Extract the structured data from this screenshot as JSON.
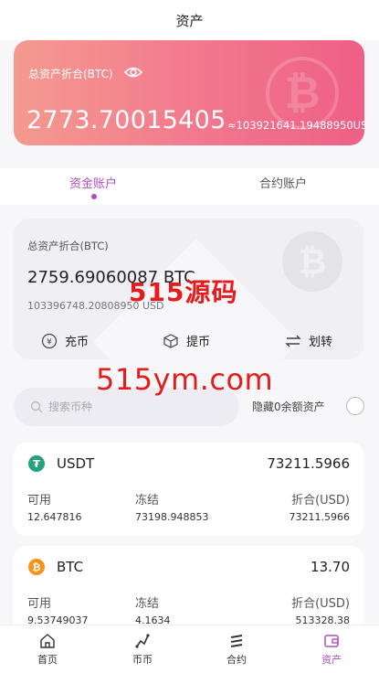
{
  "header": {
    "title": "资产"
  },
  "hero": {
    "label": "总资产折合(BTC)",
    "btc_total": "2773.70015405",
    "usd_total": "≈103921641.19488950USD",
    "eye_icon": "eye-icon"
  },
  "tabs": [
    {
      "label": "资金账户",
      "active": true
    },
    {
      "label": "合约账户",
      "active": false
    }
  ],
  "account": {
    "label": "总资产折合(BTC)",
    "balance": "2759.69060087 BTC",
    "usd": "103396748.20808950 USD",
    "actions": [
      {
        "label": "充币",
        "icon": "yen-icon"
      },
      {
        "label": "提币",
        "icon": "box-icon"
      },
      {
        "label": "划转",
        "icon": "transfer-icon"
      }
    ]
  },
  "watermarks": {
    "line1": "515源码",
    "line2": "515ym.com"
  },
  "search": {
    "placeholder": "搜索币种",
    "value": ""
  },
  "hide_zero": {
    "label": "隐藏0余额资产",
    "checked": false
  },
  "coins": [
    {
      "name": "USDT",
      "total": "73211.5966",
      "headers": [
        "可用",
        "冻结",
        "折合(USD)"
      ],
      "values": [
        "12.647816",
        "73198.948853",
        "73211.5966"
      ]
    },
    {
      "name": "BTC",
      "total": "13.70",
      "headers": [
        "可用",
        "冻结",
        "折合(USD)"
      ],
      "values": [
        "9.53749037",
        "4.1634",
        "513328.38"
      ]
    }
  ],
  "nav": [
    {
      "label": "首页",
      "icon": "home-icon",
      "active": false
    },
    {
      "label": "币币",
      "icon": "exchange-icon",
      "active": false
    },
    {
      "label": "合约",
      "icon": "contract-icon",
      "active": false
    },
    {
      "label": "资产",
      "icon": "wallet-icon",
      "active": true
    }
  ],
  "colors": {
    "accent": "#b04ec0",
    "hero_start": "#f59a8f",
    "hero_end": "#ee5f86",
    "watermark_red": "#e51c1c"
  }
}
